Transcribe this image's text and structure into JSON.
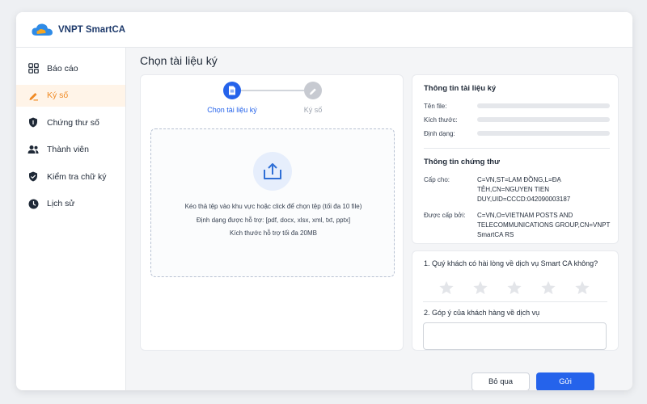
{
  "app": {
    "name": "VNPT SmartCA"
  },
  "sidebar": {
    "items": [
      {
        "label": "Báo cáo",
        "icon": "grid-icon"
      },
      {
        "label": "Ký số",
        "icon": "pen-icon"
      },
      {
        "label": "Chứng thư số",
        "icon": "shield-icon"
      },
      {
        "label": "Thành viên",
        "icon": "users-icon"
      },
      {
        "label": "Kiểm tra chữ ký",
        "icon": "shield-check-icon"
      },
      {
        "label": "Lịch sử",
        "icon": "clock-icon"
      }
    ],
    "active_index": 1
  },
  "page": {
    "title": "Chọn tài liệu ký"
  },
  "steps": [
    {
      "label": "Chọn tài liệu ký",
      "state": "active"
    },
    {
      "label": "Ký số",
      "state": "inactive"
    }
  ],
  "dropzone": {
    "line1": "Kéo thả tệp vào khu vực hoặc click để chọn tệp (tối đa 10 file)",
    "line2": "Định dạng được hỗ trợ: [pdf, docx, xlsx, xml, txt, pptx]",
    "line3": "Kích thước hỗ trợ tối đa 20MB"
  },
  "doc_info": {
    "title": "Thông tin tài liệu ký",
    "file_name_label": "Tên file:",
    "size_label": "Kích thước:",
    "format_label": "Định dạng:"
  },
  "cert_info": {
    "title": "Thông tin chứng thư",
    "issued_to_label": "Cấp cho:",
    "issued_to_value": "C=VN,ST=LAM ĐỒNG,L=ĐẠ TẺH,CN=NGUYEN TIEN DUY,UID=CCCD:042090003187",
    "issued_by_label": "Được cấp bởi:",
    "issued_by_value": "C=VN,O=VIETNAM POSTS AND TELECOMMUNICATIONS GROUP,CN=VNPT SmartCA RS"
  },
  "rating": {
    "question1": "1. Quý khách có hài lòng về dịch vụ Smart CA không?",
    "stars_total": 5,
    "stars_selected": 0,
    "question2": "2. Góp ý của khách hàng về dịch vụ",
    "feedback_value": ""
  },
  "buttons": {
    "skip": "Bỏ qua",
    "send": "Gửi"
  },
  "colors": {
    "accent": "#2563eb",
    "active_nav": "#f08a24",
    "brand": "#1e3a6b"
  }
}
